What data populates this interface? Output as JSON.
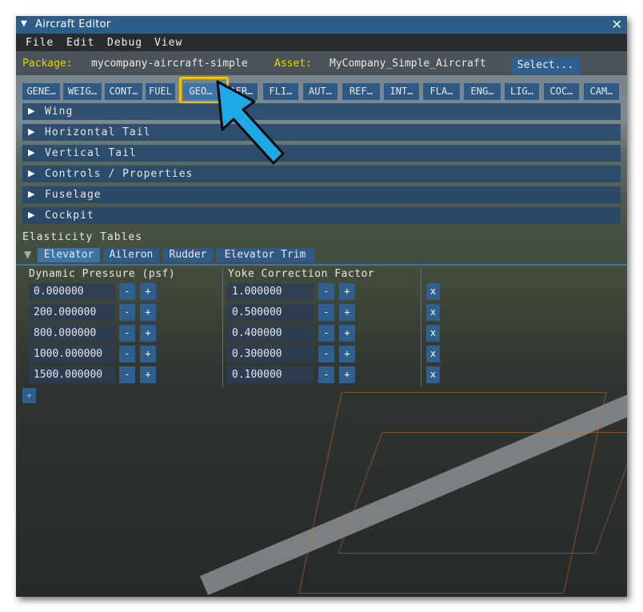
{
  "window": {
    "title": "Aircraft Editor",
    "close_glyph": "✕"
  },
  "menu": [
    "File",
    "Edit",
    "Debug",
    "View"
  ],
  "package": {
    "package_label": "Package:",
    "package_value": "mycompany-aircraft-simple",
    "asset_label": "Asset:",
    "asset_value": "MyCompany_Simple_Aircraft",
    "select_button": "Select..."
  },
  "tabs": [
    "GENE…",
    "WEIG…",
    "CONT…",
    "FUEL",
    "GEO…",
    "AER…",
    "FLI…",
    "AUT…",
    "REF…",
    "INT…",
    "FLA…",
    "ENG…",
    "LIG…",
    "COC…",
    "CAM…"
  ],
  "active_tab": "GEO…",
  "sections": [
    "Wing",
    "Horizontal Tail",
    "Vertical Tail",
    "Controls / Properties",
    "Fuselage",
    "Cockpit"
  ],
  "elasticity": {
    "label": "Elasticity Tables",
    "tabs": [
      "Elevator",
      "Aileron",
      "Rudder",
      "Elevator Trim"
    ],
    "active_tab": "Elevator",
    "col1_header": "Dynamic Pressure (psf)",
    "col2_header": "Yoke Correction Factor",
    "rows": [
      {
        "pressure": "0.000000",
        "factor": "1.000000"
      },
      {
        "pressure": "200.000000",
        "factor": "0.500000"
      },
      {
        "pressure": "800.000000",
        "factor": "0.400000"
      },
      {
        "pressure": "1000.000000",
        "factor": "0.300000"
      },
      {
        "pressure": "1500.000000",
        "factor": "0.100000"
      }
    ],
    "minus": "-",
    "plus": "+",
    "remove": "x",
    "add": "+"
  },
  "colors": {
    "title_bar": "#2d5d89",
    "label_yellow": "#e8d200",
    "highlight": "#f2c300",
    "pointer": "#1ea8e6"
  },
  "icons": [
    "collapse-triangle-icon",
    "close-icon",
    "expand-arrow-icon",
    "pointer-arrow-icon"
  ]
}
